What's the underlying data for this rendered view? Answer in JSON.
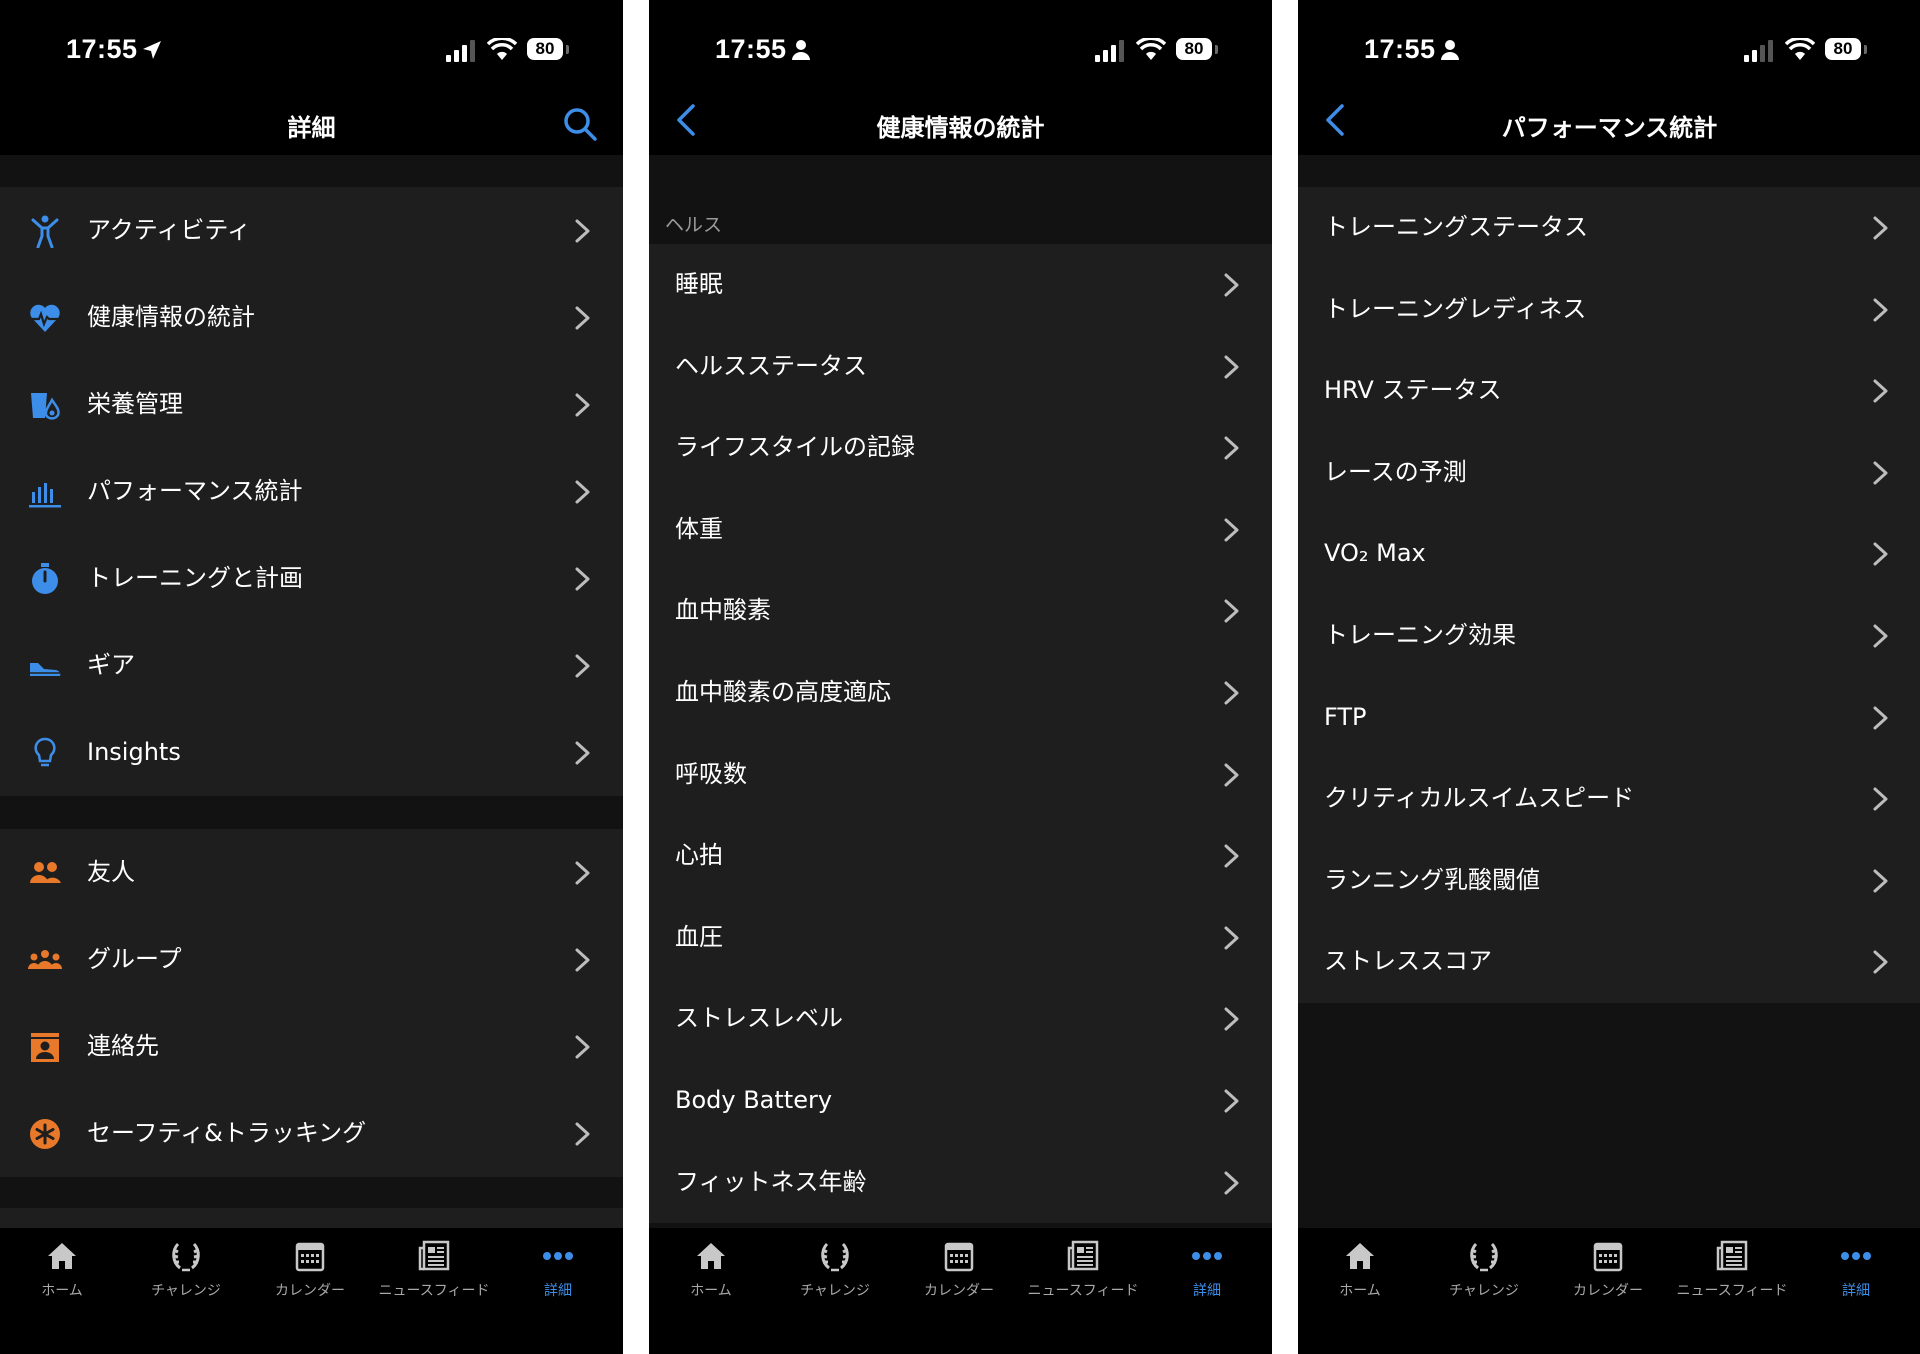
{
  "status_bar": {
    "time": "17:55",
    "battery": "80"
  },
  "screens": [
    {
      "title": "詳細",
      "groups": [
        {
          "items": [
            {
              "label": "アクティビティ",
              "icon": "activity-person-icon"
            },
            {
              "label": "健康情報の統計",
              "icon": "heart-pulse-icon"
            },
            {
              "label": "栄養管理",
              "icon": "nutrition-cup-icon"
            },
            {
              "label": "パフォーマンス統計",
              "icon": "bar-chart-icon"
            },
            {
              "label": "トレーニングと計画",
              "icon": "stopwatch-icon"
            },
            {
              "label": "ギア",
              "icon": "shoe-icon"
            },
            {
              "label": "Insights",
              "icon": "lightbulb-icon"
            }
          ]
        },
        {
          "items": [
            {
              "label": "友人",
              "icon": "friends-icon"
            },
            {
              "label": "グループ",
              "icon": "group-icon"
            },
            {
              "label": "連絡先",
              "icon": "contact-card-icon"
            },
            {
              "label": "セーフティ&トラッキング",
              "icon": "safety-asterisk-icon"
            }
          ]
        }
      ]
    },
    {
      "title": "健康情報の統計",
      "section_header": "ヘルス",
      "items": [
        "睡眠",
        "ヘルスステータス",
        "ライフスタイルの記録",
        "体重",
        "血中酸素",
        "血中酸素の高度適応",
        "呼吸数",
        "心拍",
        "血圧",
        "ストレスレベル",
        "Body Battery",
        "フィットネス年齢"
      ]
    },
    {
      "title": "パフォーマンス統計",
      "items": [
        "トレーニングステータス",
        "トレーニングレディネス",
        "HRV ステータス",
        "レースの予測",
        "VO₂ Max",
        "トレーニング効果",
        "FTP",
        "クリティカルスイムスピード",
        "ランニング乳酸閾値",
        "ストレススコア"
      ]
    }
  ],
  "tab_bar": [
    {
      "label": "ホーム",
      "icon": "home-icon"
    },
    {
      "label": "チャレンジ",
      "icon": "laurel-icon"
    },
    {
      "label": "カレンダー",
      "icon": "calendar-icon"
    },
    {
      "label": "ニュースフィード",
      "icon": "newsfeed-icon"
    },
    {
      "label": "詳細",
      "icon": "more-dots-icon",
      "active": true
    }
  ],
  "colors": {
    "accent_blue": "#3d8ee8",
    "accent_orange": "#e8782a",
    "row_bg": "#1e1e1e",
    "gap_bg": "#121212"
  }
}
